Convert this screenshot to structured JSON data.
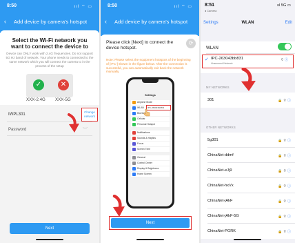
{
  "panel1": {
    "status_time": "8:50",
    "status_icons": "ııl ⌔ ▭",
    "nav_title": "Add device by camera's hotspot",
    "heading": "Select the Wi-Fi network you want to connect the device to",
    "description": "Device can ONLY work with 2.4G frequencies. Do not support 5G Hz band of network. Your phone needs to connected to the same network which you will connect the camera to in the process of the setup",
    "band_24_label": "XXX-2.4G",
    "band_5_label": "XXX-5G",
    "ssid": "IWPL301",
    "change_network": "Change network",
    "password_placeholder": "Password",
    "next_label": "Next"
  },
  "panel2": {
    "status_time": "8:50",
    "status_icons": "ııl ⌔ ▭",
    "nav_title": "Add device by camera's hotspot",
    "heading": "Please click [Next] to connect the device hotspot.",
    "note": "Note: Please select the equipment hotspots of the beginning of [IPC-] shown in the figure below. After the connection is successful, you can automatically exit back the network manually.",
    "phone_settings_title": "Settings",
    "phone_wlan_highlight": "IPC-263043bb831",
    "phone_rows": [
      "Airplane Mode",
      "WLAN",
      "Bluetooth",
      "Cellular",
      "Personal Hotspot",
      "Notifications",
      "Sounds & Haptics",
      "Focus",
      "Screen Time",
      "General",
      "Control Center",
      "Display & Brightness",
      "Home Screen"
    ],
    "next_label": "Next"
  },
  "panel3": {
    "status_time": "8:51",
    "status_sub": "◂ Camera",
    "status_icons": "ııl 5G ▭",
    "back_label": "Settings",
    "title": "WLAN",
    "edit_label": "Edit",
    "wlan_label": "WLAN",
    "connected_ssid": "IPC-263043bb831",
    "connected_sub": "Unsecured Network",
    "my_networks_header": "MY NETWORKS",
    "my_networks": [
      "301"
    ],
    "other_networks_header": "OTHER NETWORKS",
    "other_networks": [
      "5g301",
      "ChinaNet-ddmf",
      "ChinaNet-eJj9",
      "ChinaNet-hxVx",
      "ChinaNet-jAkF",
      "ChinaNet-jAkF-5G",
      "ChinaNet-PGRK"
    ],
    "row_icons": "🔒 ⌔ ⓘ"
  },
  "colors": {
    "accent_blue": "#2e9af2",
    "ios_blue": "#2e7cf6",
    "highlight_red": "#e03030",
    "toggle_green": "#34c759"
  }
}
